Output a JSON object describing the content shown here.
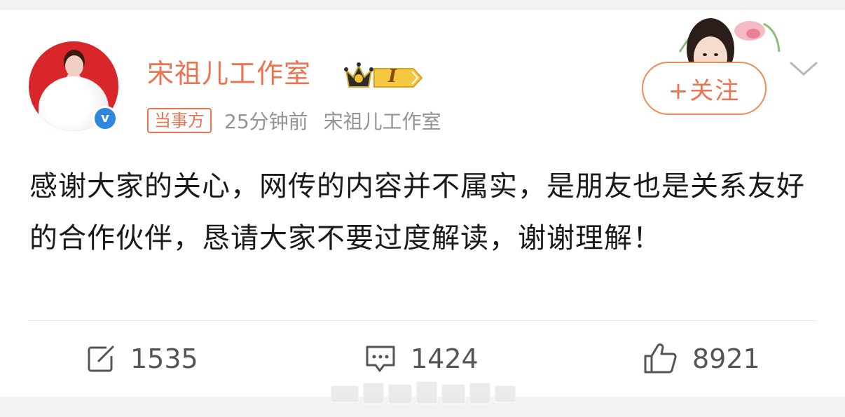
{
  "post": {
    "author": "宋祖儿工作室",
    "level_badge": "I",
    "party_tag": "当事方",
    "time": "25分钟前",
    "source": "宋祖儿工作室",
    "text": "感谢大家的关心，网传的内容并不属实，是朋友也是关系友好的合作伙伴，恳请大家不要过度解读，谢谢理解！",
    "follow_label": "+关注",
    "verified_mark": "v"
  },
  "actions": {
    "repost_count": "1535",
    "comment_count": "1424",
    "like_count": "8921"
  },
  "colors": {
    "accent": "#eb7350",
    "verify": "#2e86de",
    "text": "#1a1a1a",
    "meta": "#939393"
  },
  "icons": [
    "chevron-down-icon",
    "repost-icon",
    "comment-icon",
    "like-icon",
    "verified-icon",
    "crown-icon"
  ]
}
